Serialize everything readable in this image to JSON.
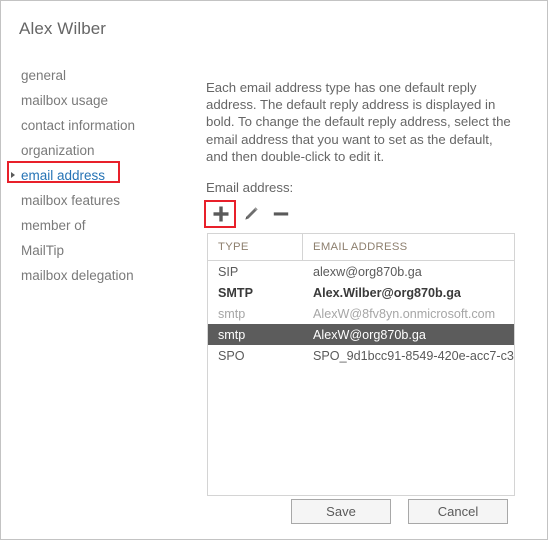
{
  "window": {
    "title": "Alex Wilber"
  },
  "sidebar": {
    "items": [
      {
        "label": "general",
        "selected": false
      },
      {
        "label": "mailbox usage",
        "selected": false
      },
      {
        "label": "contact information",
        "selected": false
      },
      {
        "label": "organization",
        "selected": false
      },
      {
        "label": "email address",
        "selected": true
      },
      {
        "label": "mailbox features",
        "selected": false
      },
      {
        "label": "member of",
        "selected": false
      },
      {
        "label": "MailTip",
        "selected": false
      },
      {
        "label": "mailbox delegation",
        "selected": false
      }
    ]
  },
  "main": {
    "description": "Each email address type has one default reply address. The default reply address is displayed in bold. To change the default reply address, select the email address that you want to set as the default, and then double-click to edit it.",
    "field_label": "Email address:",
    "toolbar": {
      "add_label": "add-icon",
      "edit_label": "edit-icon",
      "remove_label": "remove-icon"
    },
    "table": {
      "columns": [
        "TYPE",
        "EMAIL ADDRESS"
      ],
      "rows": [
        {
          "type": "SIP",
          "email": "alexw@org870b.ga",
          "style": "normal",
          "selected": false
        },
        {
          "type": "SMTP",
          "email": "Alex.Wilber@org870b.ga",
          "style": "bold",
          "selected": false
        },
        {
          "type": "smtp",
          "email": "AlexW@8fv8yn.onmicrosoft.com",
          "style": "muted",
          "selected": false
        },
        {
          "type": "smtp",
          "email": "AlexW@org870b.ga",
          "style": "normal",
          "selected": true
        },
        {
          "type": "SPO",
          "email": "SPO_9d1bcc91-8549-420e-acc7-c3...",
          "style": "normal",
          "selected": false
        }
      ]
    }
  },
  "footer": {
    "save_label": "Save",
    "cancel_label": "Cancel"
  },
  "annotations": {
    "highlight_color": "#e8202a",
    "selected_nav_color": "#2673b5",
    "selected_row_color": "#5c5c5c"
  }
}
